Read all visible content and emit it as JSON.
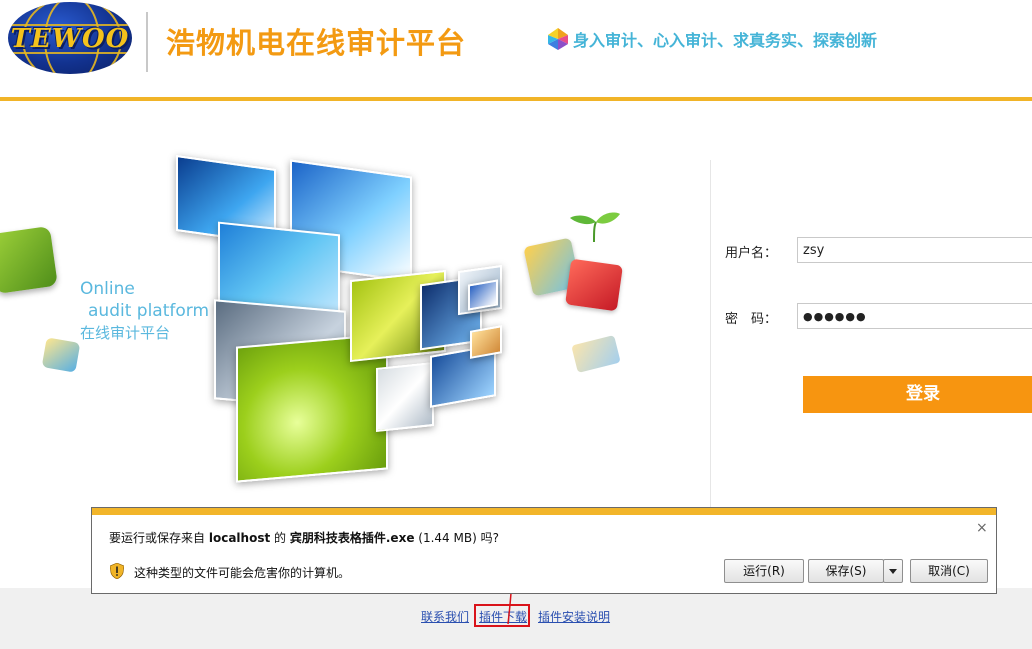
{
  "header": {
    "logo_text": "TEWOO",
    "title": "浩物机电在线审计平台",
    "slogan": "身入审计、心入审计、求真务实、探索创新",
    "accent_color": "#f39a12",
    "slogan_color": "#45b4d7",
    "rule_color": "#f1b428"
  },
  "hero": {
    "caption_line1": "Online",
    "caption_line2": "audit platform",
    "caption_line3": "在线审计平台"
  },
  "login": {
    "username_label": "用户名：",
    "username_value": "zsy",
    "password_label": "密　码：",
    "password_value": "●●●●●●",
    "submit_label": "登录",
    "button_color": "#f79510"
  },
  "footer": {
    "links": [
      "联系我们",
      "插件下载",
      "插件安装说明"
    ],
    "highlight_color": "#d9131a"
  },
  "download_bar": {
    "msg_prefix": "要运行或保存来自",
    "host": "localhost",
    "msg_of": "的",
    "filename": "宾朋科技表格插件.exe",
    "size": "(1.44 MB)",
    "msg_suffix": "吗?",
    "warning": "这种类型的文件可能会危害你的计算机。",
    "run_label": "运行(R)",
    "save_label": "保存(S)",
    "cancel_label": "取消(C)",
    "close_label": "×",
    "stripe_color": "#f2b52a"
  }
}
